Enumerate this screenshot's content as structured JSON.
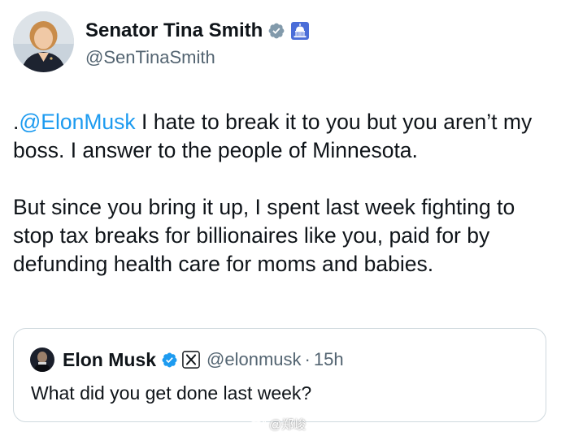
{
  "author": {
    "display_name": "Senator Tina Smith",
    "handle": "@SenTinaSmith",
    "verified_icon": "verified-check-icon",
    "affiliation_icon": "capitol-building-icon",
    "verified_color": "#829aab",
    "affiliation_color": "#4a6dd8"
  },
  "tweet": {
    "paragraph1_prefix": ".",
    "paragraph1_mention": "@ElonMusk",
    "paragraph1_rest": " I hate to break it to you but you aren’t my boss. I answer to the people of Minnesota.",
    "paragraph2": "But since you bring it up, I spent last week fighting to stop tax breaks for billionaires like you, paid for by defunding health care for moms and babies.",
    "mention_color": "#1d9bf0"
  },
  "quoted_tweet": {
    "display_name": "Elon Musk",
    "handle": "@elonmusk",
    "separator": "·",
    "time": "15h",
    "text": "What did you get done last week?",
    "verified_icon": "verified-check-icon",
    "affiliation_icon": "x-logo-icon",
    "verified_color": "#1d9bf0"
  },
  "watermark": {
    "icon": "weibo-icon",
    "text": "@郑峻"
  }
}
